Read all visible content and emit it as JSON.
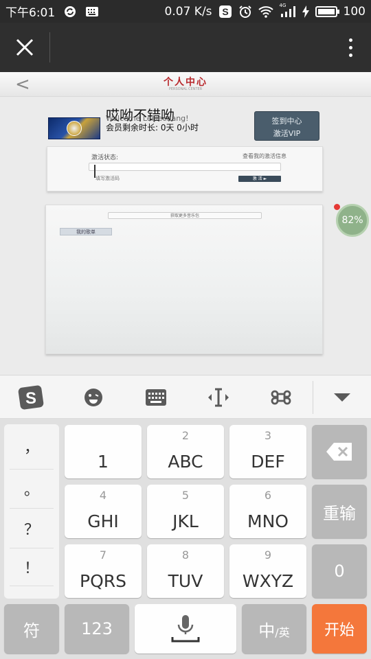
{
  "status_bar": {
    "time": "下午6:01",
    "net_speed": "0.07 K/s",
    "signal_type": "4G",
    "battery_level": "100",
    "icons": [
      "sync-icon",
      "keyboard-icon",
      "s-app-icon",
      "alarm-icon",
      "wifi-icon",
      "signal-icon",
      "charging-icon",
      "battery-icon"
    ]
  },
  "title_bar": {
    "close_icon": "close-icon",
    "more_icon": "more-vertical-icon"
  },
  "web_header": {
    "back": "<",
    "title": "个人中心",
    "subtitle": "PERSONAL CENTER"
  },
  "profile": {
    "username": "哎呦不错呦",
    "welcome": "Welcome Leijiechang!",
    "remaining": "会员剩余时长: 0天 0小时",
    "sign_button_line1": "签到中心",
    "sign_button_line2": "激活VIP"
  },
  "activation": {
    "status_label": "激活状态:",
    "view_link": "查看我的激活信息",
    "code_placeholder": "填写激活码",
    "activate_button": "激 活"
  },
  "music": {
    "more_music_button": "获取更多音乐包",
    "my_list_button": "我的歌单"
  },
  "floating_badge": {
    "percent": "82%"
  },
  "ime_toolbar": {
    "tools": [
      "sogou-logo-icon",
      "emoji-icon",
      "keyboard-icon",
      "cursor-move-icon",
      "command-icon",
      "collapse-icon"
    ]
  },
  "keyboard": {
    "symbols": [
      "，",
      "。",
      "？",
      "！"
    ],
    "keys_row1": [
      {
        "sub": "",
        "main": "1"
      },
      {
        "sub": "2",
        "main": "ABC"
      },
      {
        "sub": "3",
        "main": "DEF"
      }
    ],
    "keys_row2": [
      {
        "sub": "4",
        "main": "GHI"
      },
      {
        "sub": "5",
        "main": "JKL"
      },
      {
        "sub": "6",
        "main": "MNO"
      }
    ],
    "keys_row3": [
      {
        "sub": "7",
        "main": "PQRS"
      },
      {
        "sub": "8",
        "main": "TUV"
      },
      {
        "sub": "9",
        "main": "WXYZ"
      }
    ],
    "reinput": "重输",
    "zero": "0",
    "symbol_key": "符",
    "num_key": "123",
    "lang_main": "中",
    "lang_sub": "/英",
    "start_key": "开始"
  },
  "colors": {
    "status_bar_bg": "#2b2b2b",
    "title_bar_bg": "#2f2f2f",
    "accent_red": "#b8282c",
    "start_key": "#f4773b",
    "badge": "#8fb28a"
  }
}
